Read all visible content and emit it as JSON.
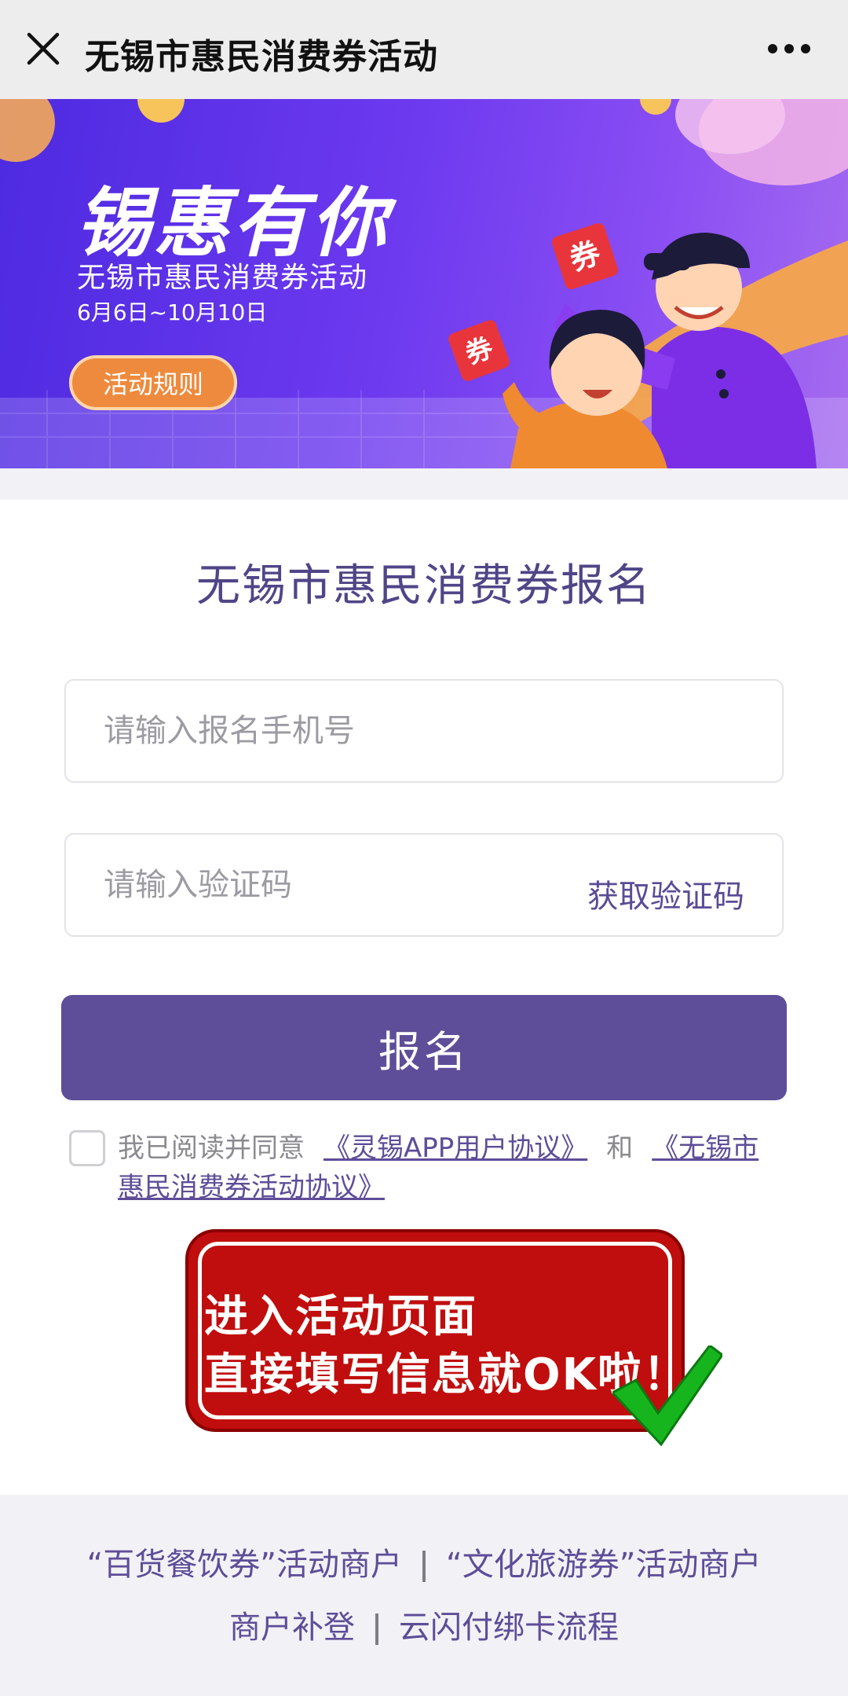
{
  "navbar": {
    "title": "无锡市惠民消费券活动",
    "close_icon": "close-icon",
    "more_icon": "more-dots-icon"
  },
  "banner": {
    "headline": "锡惠有你",
    "subtitle": "无锡市惠民消费券活动",
    "date": "6月6日~10月10日",
    "rules_button": "活动规则",
    "ticket_text": "券"
  },
  "form": {
    "title": "无锡市惠民消费券报名",
    "phone_placeholder": "请输入报名手机号",
    "code_placeholder": "请输入验证码",
    "get_code": "获取验证码",
    "submit": "报名"
  },
  "agreement": {
    "prefix": "我已阅读并同意",
    "link1": "《灵锡APP用户协议》",
    "conjunction": "和",
    "link2": "《无锡市惠民消费券活动协议》"
  },
  "promo": {
    "line1": "进入活动页面",
    "line2": "直接填写信息就OK啦！"
  },
  "footer": {
    "link1": "“百货餐饮券”活动商户",
    "link2": "“文化旅游券”活动商户",
    "link3": "商户补登",
    "link4": "云闪付绑卡流程"
  },
  "colors": {
    "accent": "#5e4d98",
    "banner": "#6c39ef",
    "promo_red": "#c00d0d",
    "check_green": "#17b51d"
  }
}
